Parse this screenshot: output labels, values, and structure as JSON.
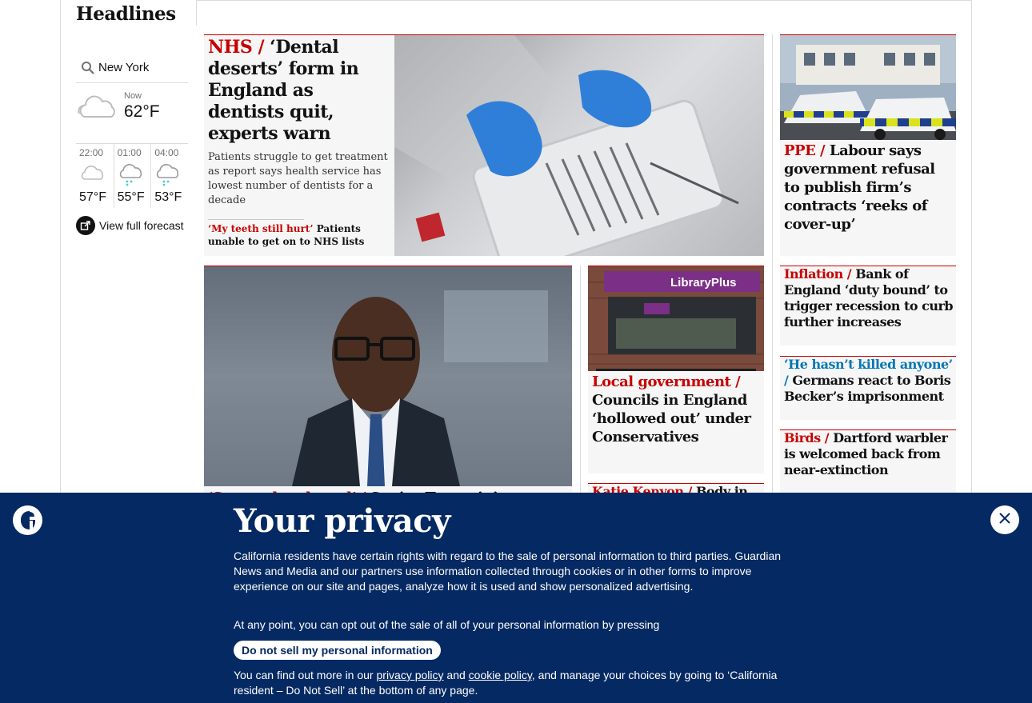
{
  "section": {
    "title": "Headlines"
  },
  "weather": {
    "location": "New York",
    "now_label": "Now",
    "now_temp": "62°F",
    "now_icon": "cloudy-icon",
    "hours": [
      {
        "time": "22:00",
        "temp": "57°F",
        "icon": "cloudy-icon"
      },
      {
        "time": "01:00",
        "temp": "55°F",
        "icon": "rain-icon"
      },
      {
        "time": "04:00",
        "temp": "53°F",
        "icon": "rain-icon"
      }
    ],
    "forecast_link": "View full forecast"
  },
  "stories": {
    "main": {
      "kicker": "NHS /",
      "headline": "‘Dental deserts’ form in England as dentists quit, experts warn",
      "standfirst": "Patients struggle to get treatment as report says health service has lowest number of dentists for a decade",
      "sublink_kicker": "‘My teeth still hurt’",
      "sublink_text": "Patients unable to get on to NHS lists"
    },
    "ppe": {
      "kicker": "PPE /",
      "headline": "Labour says government refusal to publish firm’s contracts ‘reeks of cover-up’"
    },
    "inflation": {
      "kicker": "Inflation /",
      "headline": "Bank of England ‘duty bound’ to trigger recession to curb further increases"
    },
    "becker": {
      "kicker": "‘He hasn’t killed anyone’ /",
      "headline": "Germans react to Boris Becker’s imprisonment"
    },
    "birds": {
      "kicker": "Birds /",
      "headline": "Dartford warbler is welcomed back from near-extinction"
    },
    "localgov": {
      "kicker": "Local government /",
      "headline": "Councils in England ‘hollowed out’ under Conservatives"
    },
    "kenyon": {
      "kicker": "Katie Kenyon /",
      "headline": "Body in"
    },
    "kwarteng": {
      "kicker": "‘Screwed and used’ /",
      "headline": "Senior Tory minister"
    }
  },
  "banner": {
    "title": "Your privacy",
    "para1": "California residents have certain rights with regard to the sale of personal information to third parties. Guardian News and Media and our partners use information collected through cookies or in other forms to improve experience on our site and pages, analyze how it is used and show personalized advertising.",
    "para2": "At any point, you can opt out of the sale of all of your personal information by pressing",
    "button": "Do not sell my personal information",
    "para3_a": "You can find out more in our",
    "privacy_link": "privacy policy",
    "and": "and",
    "cookie_link": "cookie policy",
    "para3_b": ", and manage your choices by going to ‘California resident – Do Not Sell’ at the bottom of any page."
  }
}
